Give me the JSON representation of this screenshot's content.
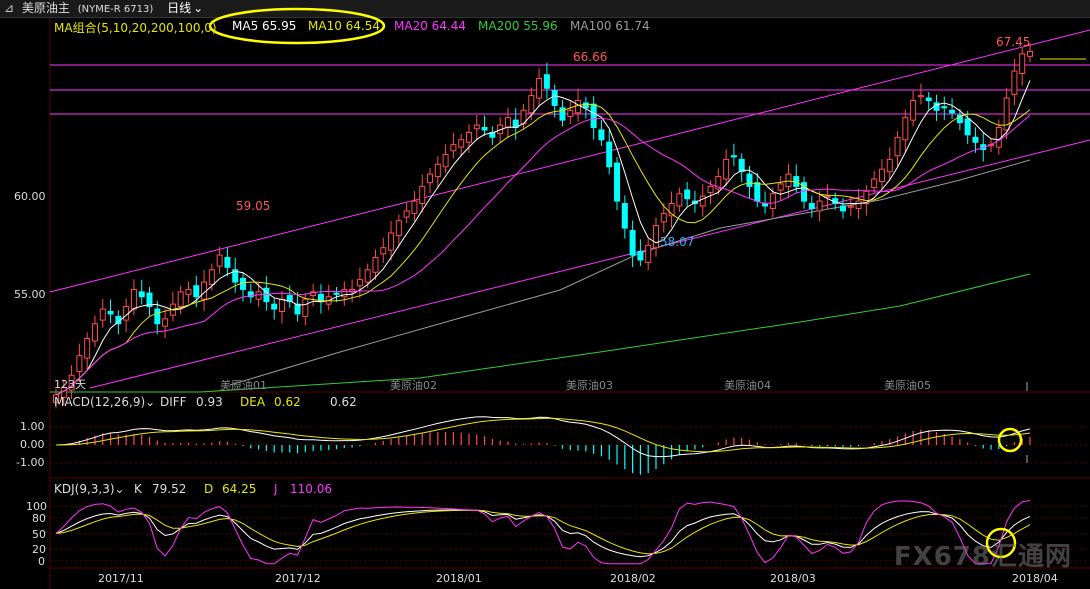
{
  "header": {
    "pin_icon": "pin-icon",
    "instrument": "美原油主",
    "code": "(NYME-R 6713)",
    "period": "日线"
  },
  "ma_legend": {
    "group_label": "MA组合(5,10,20,200,100,0)",
    "items": [
      {
        "label": "MA5 65.95",
        "color": "#ffffff"
      },
      {
        "label": "MA10 64.54",
        "color": "#e6e600"
      },
      {
        "label": "MA20 64.44",
        "color": "#ff33ff"
      },
      {
        "label": "MA200 55.96",
        "color": "#33cc33"
      },
      {
        "label": "MA100 61.74",
        "color": "#9a9a9a"
      }
    ]
  },
  "price_axis": [
    "60.00",
    "55.00"
  ],
  "annotations": {
    "high1": "66.66",
    "high2": "67.45",
    "mid_high": "59.05",
    "low": "58.07",
    "days": "123天"
  },
  "contract_marks": [
    "美原油01",
    "美原油02",
    "美原油03",
    "美原油04",
    "美原油05"
  ],
  "macd": {
    "label": "MACD(12,26,9)",
    "diff_label": "DIFF",
    "diff_value": "0.93",
    "dea_label": "DEA",
    "dea_value": "0.62",
    "macd_value": "0.62",
    "axis": [
      "1.00",
      "0.00",
      "-1.00"
    ]
  },
  "kdj": {
    "label": "KDJ(9,3,3)",
    "k_label": "K",
    "k_value": "79.52",
    "d_label": "D",
    "d_value": "64.25",
    "j_label": "J",
    "j_value": "110.06",
    "axis": [
      "100",
      "80",
      "50",
      "20",
      "0"
    ]
  },
  "date_axis": [
    "2017/11",
    "2017/12",
    "2018/01",
    "2018/02",
    "2018/03",
    "2018/04"
  ],
  "watermark": "FX678汇通网",
  "colors": {
    "up": "#ff4d4d",
    "down": "#00ffff",
    "trend": "#ff33ff",
    "highlight": "#ffff00"
  },
  "chart_data": {
    "type": "candlestick",
    "instrument": "美原油主",
    "period": "日线",
    "ylim": [
      53.5,
      68.5
    ],
    "x_range": [
      "2017-11-01",
      "2018-04-03"
    ],
    "close_series": [
      53.3,
      53.6,
      54.1,
      54.9,
      55.6,
      56.2,
      56.8,
      56.6,
      56.2,
      56.9,
      57.6,
      57.3,
      56.9,
      56.2,
      56.4,
      57.0,
      57.5,
      57.6,
      57.3,
      57.9,
      58.4,
      59.0,
      58.5,
      57.9,
      57.6,
      57.3,
      57.5,
      57.1,
      56.8,
      57.2,
      57.1,
      56.6,
      57.2,
      57.5,
      57.1,
      57.3,
      57.4,
      57.6,
      57.6,
      58.0,
      58.4,
      58.9,
      59.3,
      59.9,
      60.4,
      60.8,
      61.2,
      61.8,
      62.3,
      62.7,
      63.1,
      63.5,
      63.7,
      64.0,
      64.3,
      64.1,
      63.8,
      64.3,
      64.6,
      64.2,
      64.9,
      65.5,
      66.2,
      65.8,
      65.1,
      64.5,
      64.9,
      65.3,
      65.0,
      64.2,
      63.7,
      62.6,
      61.2,
      60.1,
      59.0,
      58.8,
      59.4,
      60.2,
      60.7,
      61.1,
      61.5,
      61.3,
      61.1,
      61.4,
      61.8,
      62.2,
      62.9,
      63.0,
      62.4,
      61.8,
      61.2,
      61.0,
      61.5,
      61.9,
      62.3,
      61.8,
      61.2,
      60.9,
      61.2,
      61.4,
      61.1,
      60.8,
      61.0,
      61.2,
      61.6,
      62.1,
      62.5,
      62.9,
      63.8,
      64.6,
      65.3,
      65.5,
      65.3,
      64.9,
      65.0,
      64.8,
      64.4,
      63.9,
      63.6,
      63.3,
      63.5,
      64.2,
      65.4,
      66.5,
      67.2,
      67.3
    ]
  }
}
